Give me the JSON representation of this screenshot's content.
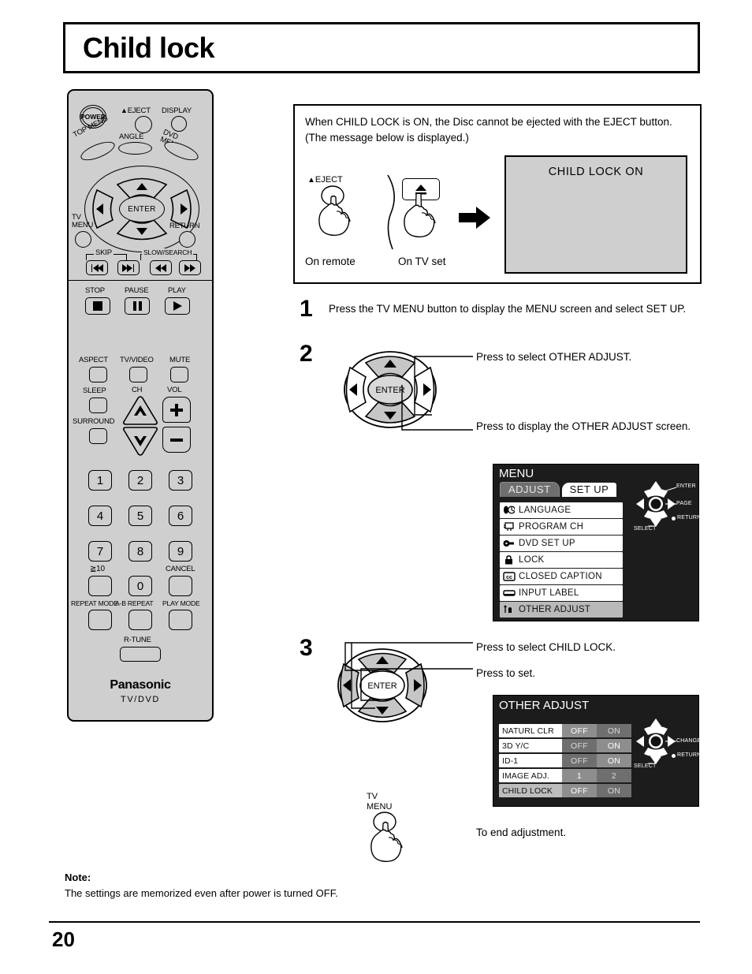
{
  "page": {
    "title": "Child lock",
    "number": "20"
  },
  "remote": {
    "power_label": "POWER",
    "eject_label": "EJECT",
    "display_label": "DISPLAY",
    "top_menu_label": "TOP MENU",
    "angle_label": "ANGLE",
    "dvd_menu_label": "DVD MENU",
    "dvd_menu_line1": "DVD",
    "dvd_menu_line2": "MENU",
    "enter_label": "ENTER",
    "tv_menu_line1": "TV",
    "tv_menu_line2": "MENU",
    "return_label": "RETURN",
    "skip_label": "SKIP",
    "slow_search_label": "SLOW/SEARCH",
    "stop_label": "STOP",
    "pause_label": "PAUSE",
    "play_label": "PLAY",
    "aspect_label": "ASPECT",
    "tv_video_label": "TV/VIDEO",
    "mute_label": "MUTE",
    "sleep_label": "SLEEP",
    "ch_label": "CH",
    "vol_label": "VOL",
    "surround_label": "SURROUND",
    "numbers": [
      "1",
      "2",
      "3",
      "4",
      "5",
      "6",
      "7",
      "8",
      "9"
    ],
    "zero_label": "0",
    "over10_label": "≧10",
    "cancel_label": "CANCEL",
    "repeat_mode_label": "REPEAT MODE",
    "ab_repeat_label": "A-B REPEAT",
    "play_mode_label": "PLAY MODE",
    "r_tune_label": "R-TUNE",
    "brand": "Panasonic",
    "brand_sub": "TV/DVD"
  },
  "info_box": {
    "text": "When CHILD LOCK is ON, the Disc cannot be ejected with the EJECT button. (The message below is displayed.)",
    "eject_label": "EJECT",
    "on_remote_label": "On remote",
    "on_tv_label": "On TV set",
    "tv_message": "CHILD  LOCK  ON"
  },
  "steps": [
    {
      "number": "1",
      "text": "Press the TV MENU button to display the MENU screen and select SET UP."
    },
    {
      "number": "2",
      "callout_top": "Press to select OTHER ADJUST.",
      "callout_bottom": "Press to display the OTHER ADJUST screen.",
      "enter_label": "ENTER"
    },
    {
      "number": "3",
      "callout_top": "Press to select CHILD LOCK.",
      "callout_bottom": "Press to set.",
      "enter_label": "ENTER"
    }
  ],
  "menu_osd": {
    "title": "MENU",
    "tabs": [
      {
        "label": "ADJUST",
        "active": false
      },
      {
        "label": "SET  UP",
        "active": true
      }
    ],
    "items": [
      {
        "label": "LANGUAGE",
        "icon": "language-icon",
        "selected": false
      },
      {
        "label": "PROGRAM  CH",
        "icon": "program-ch-icon",
        "selected": false
      },
      {
        "label": "DVD  SET  UP",
        "icon": "dvd-setup-icon",
        "selected": false
      },
      {
        "label": "LOCK",
        "icon": "lock-icon",
        "selected": false
      },
      {
        "label": "CLOSED CAPTION",
        "icon": "closed-caption-icon",
        "selected": false
      },
      {
        "label": "INPUT  LABEL",
        "icon": "input-label-icon",
        "selected": false
      },
      {
        "label": "OTHER  ADJUST",
        "icon": "other-adjust-icon",
        "selected": true
      }
    ],
    "nav": {
      "enter": "ENTER",
      "page": "PAGE",
      "return": "RETURN",
      "select": "SELECT"
    }
  },
  "other_adjust_osd": {
    "title": "OTHER ADJUST",
    "rows": [
      {
        "name": "NATURL CLR",
        "values": [
          {
            "label": "OFF",
            "state": "hot"
          },
          {
            "label": "ON",
            "state": "dim"
          }
        ],
        "row_selected": false
      },
      {
        "name": "3D Y/C",
        "values": [
          {
            "label": "OFF",
            "state": "dim"
          },
          {
            "label": "ON",
            "state": "hot"
          }
        ],
        "row_selected": false
      },
      {
        "name": "ID-1",
        "values": [
          {
            "label": "OFF",
            "state": "dim"
          },
          {
            "label": "ON",
            "state": "hot"
          }
        ],
        "row_selected": false
      },
      {
        "name": "IMAGE ADJ.",
        "values": [
          {
            "label": "1",
            "state": "hot"
          },
          {
            "label": "2",
            "state": "dim"
          }
        ],
        "row_selected": false
      },
      {
        "name": "CHILD LOCK",
        "values": [
          {
            "label": "OFF",
            "state": "hot"
          },
          {
            "label": "ON",
            "state": "dim"
          }
        ],
        "row_selected": true
      }
    ],
    "nav": {
      "change": "CHANGE",
      "return": "RETURN",
      "select": "SELECT"
    }
  },
  "ending": {
    "tv_menu_line1": "TV",
    "tv_menu_line2": "MENU",
    "text": "To end adjustment."
  },
  "note": {
    "heading": "Note:",
    "body": "The settings are memorized even after power is turned OFF."
  }
}
